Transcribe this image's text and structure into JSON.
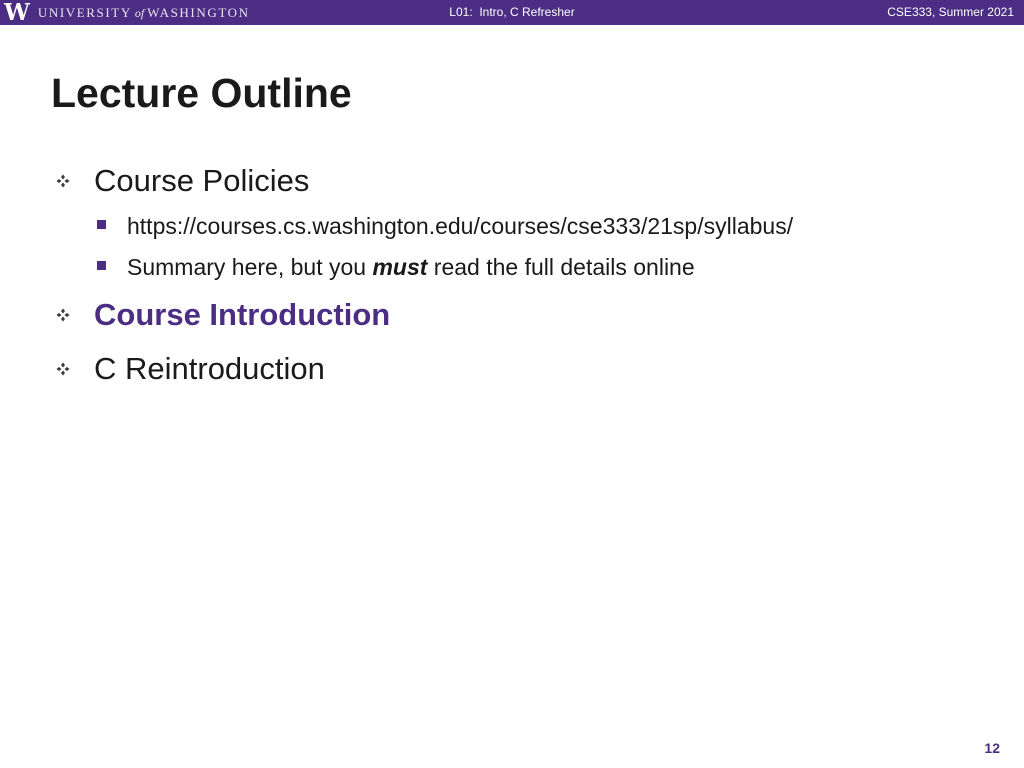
{
  "header": {
    "logo_letter": "W",
    "logo_text_1": "UNIVERSITY",
    "logo_text_of": "of",
    "logo_text_2": "WASHINGTON",
    "lecture": "L01:  Intro, C Refresher",
    "course": "CSE333, Summer 2021"
  },
  "slide": {
    "title": "Lecture Outline",
    "outline": [
      {
        "label": "Course Policies",
        "sub": [
          {
            "text": "https://courses.cs.washington.edu/courses/cse333/21sp/syllabus/"
          },
          {
            "before": "Summary here, but you ",
            "emphasis": "must",
            "after": " read the full details online"
          }
        ]
      },
      {
        "label": "Course Introduction",
        "highlighted": true
      },
      {
        "label": "C Reintroduction"
      }
    ],
    "page_number": "12"
  },
  "colors": {
    "accent": "#4b2e83",
    "text": "#1a1a1a",
    "background": "#ffffff"
  },
  "icons": {
    "level1_bullet": "four-diamond-bullet-icon",
    "level2_bullet": "square-bullet-icon"
  }
}
